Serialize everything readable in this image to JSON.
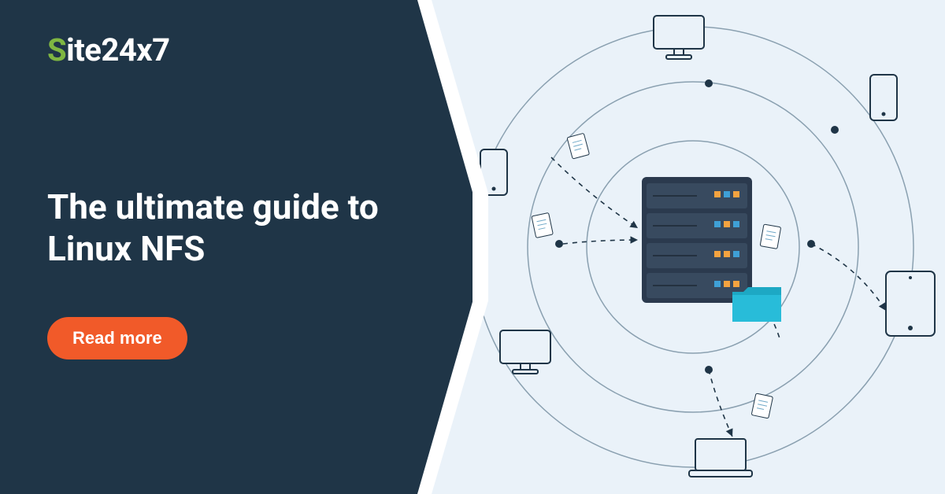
{
  "logo": {
    "part1": "S",
    "part2": "ite",
    "part3": "24x7"
  },
  "headline": "The ultimate guide to Linux NFS",
  "cta_label": "Read more",
  "colors": {
    "dark_bg": "#1f3547",
    "light_bg": "#eaf2f9",
    "accent_green": "#7fb642",
    "accent_orange": "#f15a29",
    "server_body": "#2b3a4e",
    "server_shelf": "#384a5f",
    "led_orange": "#f4a340",
    "led_blue": "#3fa0d6",
    "folder": "#28bcd9",
    "stroke": "#1f3547"
  },
  "diagram": {
    "devices": [
      {
        "type": "monitor",
        "pos": "top"
      },
      {
        "type": "phone",
        "pos": "top-right"
      },
      {
        "type": "tablet",
        "pos": "right"
      },
      {
        "type": "laptop",
        "pos": "bottom-right"
      },
      {
        "type": "monitor",
        "pos": "bottom-left"
      },
      {
        "type": "phone",
        "pos": "left"
      }
    ],
    "center": "server-rack-with-folder"
  }
}
